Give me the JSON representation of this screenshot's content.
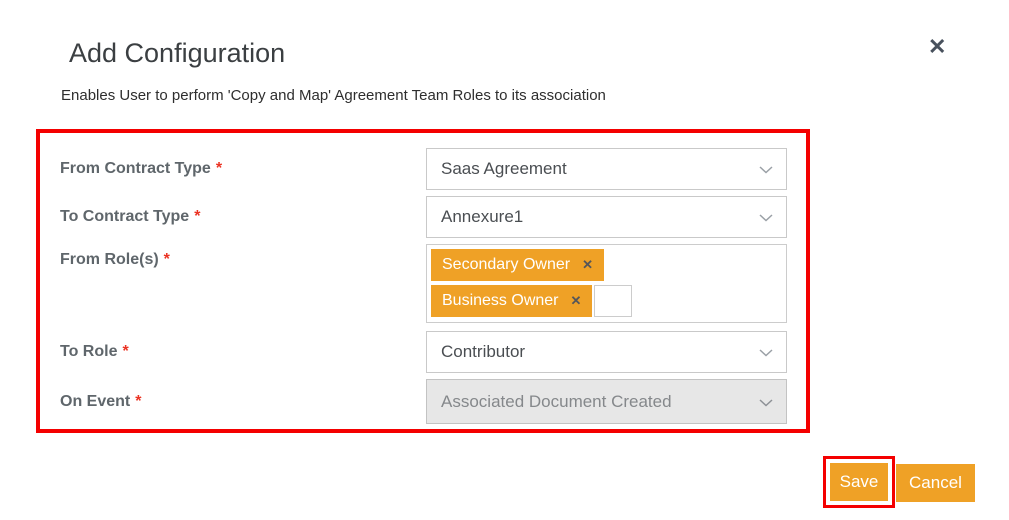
{
  "dialog": {
    "title": "Add Configuration",
    "subtitle": "Enables User to perform 'Copy and Map' Agreement Team Roles to its association"
  },
  "icons": {
    "close": "✕",
    "tag_remove": "✕"
  },
  "form": {
    "required_marker": "*",
    "fields": [
      {
        "label": "From Contract Type",
        "type": "select",
        "value": "Saas Agreement"
      },
      {
        "label": "To Contract Type",
        "type": "select",
        "value": "Annexure1"
      },
      {
        "label": "From Role(s)",
        "type": "multiselect",
        "tags": [
          "Secondary Owner",
          "Business Owner"
        ]
      },
      {
        "label": "To Role",
        "type": "select",
        "value": "Contributor"
      },
      {
        "label": "On Event",
        "type": "select",
        "value": "Associated Document Created",
        "disabled": true
      }
    ]
  },
  "buttons": {
    "save": "Save",
    "cancel": "Cancel"
  },
  "colors": {
    "accent_orange": "#EFA126",
    "annotation_red": "#F40000",
    "disabled_field_bg": "#E7E7E7"
  }
}
